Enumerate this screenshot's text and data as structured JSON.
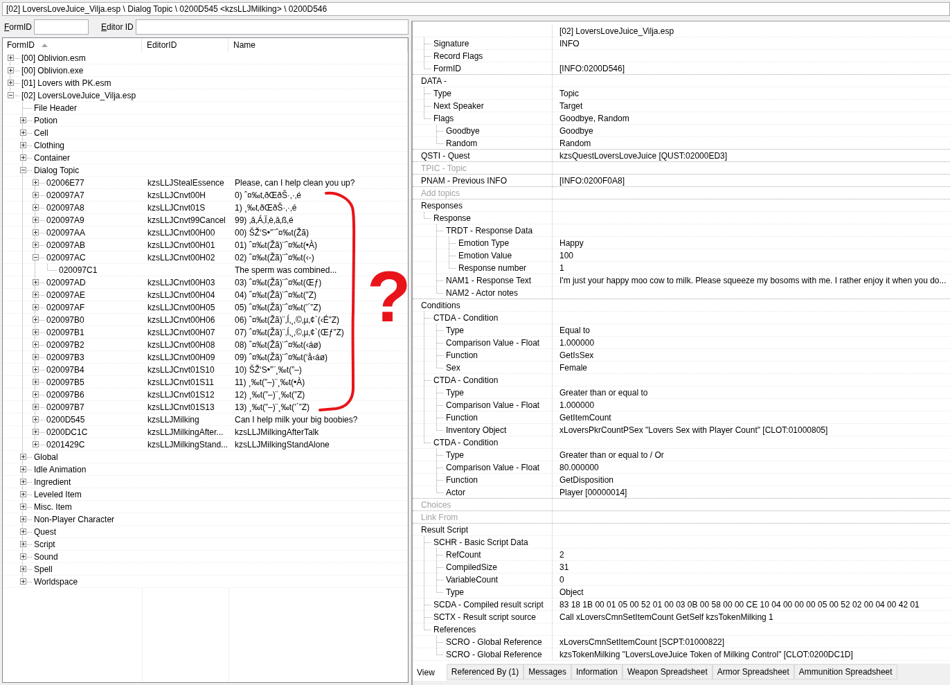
{
  "path_bar": "[02] LoversLoveJuice_Vilja.esp \\ Dialog Topic \\ 0200D545 <kzsLLJMilking> \\ 0200D546",
  "filters": [
    {
      "label": "FormID"
    },
    {
      "label": "Editor ID"
    }
  ],
  "record_tree": {
    "columns": [
      {
        "label": "FormID",
        "sorted": true
      },
      {
        "label": "EditorID",
        "sorted": false
      },
      {
        "label": "Name",
        "sorted": false
      }
    ],
    "nodes": [
      {
        "label": "[00] Oblivion.esm",
        "kind": "branch",
        "expanded": false
      },
      {
        "label": "[00] Oblivion.exe",
        "kind": "branch",
        "expanded": false
      },
      {
        "label": "[01] Lovers with PK.esm",
        "kind": "branch",
        "expanded": false
      },
      {
        "label": "[02] LoversLoveJuice_Vilja.esp",
        "kind": "branch",
        "expanded": true,
        "children": [
          {
            "label": "File Header",
            "kind": "leaf"
          },
          {
            "label": "Potion",
            "kind": "branch",
            "expanded": false
          },
          {
            "label": "Cell",
            "kind": "branch",
            "expanded": false
          },
          {
            "label": "Clothing",
            "kind": "branch",
            "expanded": false
          },
          {
            "label": "Container",
            "kind": "branch",
            "expanded": false
          },
          {
            "label": "Dialog Topic",
            "kind": "branch",
            "expanded": true,
            "children": [
              {
                "label": "02006E77",
                "editor_id": "kzsLLJStealEssence",
                "name": "Please, can I help clean you up?",
                "kind": "branch",
                "expanded": false
              },
              {
                "label": "020097A7",
                "editor_id": "kzsLLJCnvt00H",
                "name": "0) ˆ¤‰t‚ðŒðŠ·‚·‚é",
                "kind": "branch",
                "expanded": false
              },
              {
                "label": "020097A8",
                "editor_id": "kzsLLJCnvt01S",
                "name": "1) ¸‰t‚ðŒðŠ·‚·‚é",
                "kind": "branch",
                "expanded": false
              },
              {
                "label": "020097A9",
                "editor_id": "kzsLLJCnvt99Cancel",
                "name": "99) ‚â‚Á‚Ï‚è‚â‚ß‚é",
                "kind": "branch",
                "expanded": false
              },
              {
                "label": "020097AA",
                "editor_id": "kzsLLJCnvt00H00",
                "name": "00) ŠŽ‘S•”¨ˆ¤‰t(Žã)",
                "kind": "branch",
                "expanded": false
              },
              {
                "label": "020097AB",
                "editor_id": "kzsLLJCnvt00H01",
                "name": "01) ˆ¤‰t(Žã)¨ˆ¤‰t(•À)",
                "kind": "branch",
                "expanded": false
              },
              {
                "label": "020097AC",
                "editor_id": "kzsLLJCnvt00H02",
                "name": "02) ˆ¤‰t(Žã)¨ˆ¤‰t(‹-)",
                "kind": "branch",
                "expanded": true,
                "children": [
                  {
                    "label": "020097C1",
                    "name": "The sperm was combined...",
                    "kind": "leaf"
                  }
                ]
              },
              {
                "label": "020097AD",
                "editor_id": "kzsLLJCnvt00H03",
                "name": "03) ˆ¤‰t(Žã)¨ˆ¤‰t(Œƒ)",
                "kind": "branch",
                "expanded": false
              },
              {
                "label": "020097AE",
                "editor_id": "kzsLLJCnvt00H04",
                "name": "04) ˆ¤‰t(Žã)¨ˆ¤‰t(”Z)",
                "kind": "branch",
                "expanded": false
              },
              {
                "label": "020097AF",
                "editor_id": "kzsLLJCnvt00H05",
                "name": "05) ˆ¤‰t(Žã)¨ˆ¤‰t(’´”Z)",
                "kind": "branch",
                "expanded": false
              },
              {
                "label": "020097B0",
                "editor_id": "kzsLLJCnvt00H06",
                "name": "06) ˆ¤‰t(Žã)¨‚Í‚¸‚©‚µ‚¢`(‹É”Z)",
                "kind": "branch",
                "expanded": false
              },
              {
                "label": "020097B1",
                "editor_id": "kzsLLJCnvt00H07",
                "name": "07) ˆ¤‰t(Žã)¨‚Í‚¸‚©‚µ‚¢`(Œƒ”Z)",
                "kind": "branch",
                "expanded": false
              },
              {
                "label": "020097B2",
                "editor_id": "kzsLLJCnvt00H08",
                "name": "08) ˆ¤‰t(Žã)¨ˆ¤‰t(‹áø)",
                "kind": "branch",
                "expanded": false
              },
              {
                "label": "020097B3",
                "editor_id": "kzsLLJCnvt00H09",
                "name": "09) ˆ¤‰t(Žã)¨ˆ¤‰t(‘å‹áø)",
                "kind": "branch",
                "expanded": false
              },
              {
                "label": "020097B4",
                "editor_id": "kzsLLJCnvt01S10",
                "name": "10) ŠŽ‘S•”¨¸‰t(”–)",
                "kind": "branch",
                "expanded": false
              },
              {
                "label": "020097B5",
                "editor_id": "kzsLLJCnvt01S11",
                "name": "11) ¸‰t(”–)¨¸‰t(•À)",
                "kind": "branch",
                "expanded": false
              },
              {
                "label": "020097B6",
                "editor_id": "kzsLLJCnvt01S12",
                "name": "12) ¸‰t(”–)¨¸‰t(”Z)",
                "kind": "branch",
                "expanded": false
              },
              {
                "label": "020097B7",
                "editor_id": "kzsLLJCnvt01S13",
                "name": "13) ¸‰t(”–)¨¸‰t(’´”Z)",
                "kind": "branch",
                "expanded": false
              },
              {
                "label": "0200D545",
                "editor_id": "kzsLLJMilking",
                "name": "Can I help milk your big boobies?",
                "kind": "branch",
                "expanded": false
              },
              {
                "label": "0200DC1C",
                "editor_id": "kzsLLJMilkingAfter...",
                "name": "kzsLLJMilkingAfterTalk",
                "kind": "branch",
                "expanded": false
              },
              {
                "label": "0201429C",
                "editor_id": "kzsLLJMilkingStand...",
                "name": "kzsLLJMilkingStandAlone",
                "kind": "branch",
                "expanded": false
              }
            ]
          },
          {
            "label": "Global",
            "kind": "branch",
            "expanded": false
          },
          {
            "label": "Idle Animation",
            "kind": "branch",
            "expanded": false
          },
          {
            "label": "Ingredient",
            "kind": "branch",
            "expanded": false
          },
          {
            "label": "Leveled Item",
            "kind": "branch",
            "expanded": false
          },
          {
            "label": "Misc. Item",
            "kind": "branch",
            "expanded": false
          },
          {
            "label": "Non-Player Character",
            "kind": "branch",
            "expanded": false
          },
          {
            "label": "Quest",
            "kind": "branch",
            "expanded": false
          },
          {
            "label": "Script",
            "kind": "branch",
            "expanded": false
          },
          {
            "label": "Sound",
            "kind": "branch",
            "expanded": false
          },
          {
            "label": "Spell",
            "kind": "branch",
            "expanded": false
          },
          {
            "label": "Worldspace",
            "kind": "branch",
            "expanded": false
          }
        ]
      }
    ]
  },
  "record_view": {
    "fields": [
      {
        "value": "[02] LoversLoveJuice_Vilja.esp",
        "disabled": false,
        "children": [
          {
            "label": "Signature",
            "value": "INFO"
          },
          {
            "label": "Record Flags"
          },
          {
            "label": "FormID",
            "value": "[INFO:0200D546]"
          }
        ]
      },
      {
        "label": "DATA -",
        "disabled": false,
        "children": [
          {
            "label": "Type",
            "value": "Topic"
          },
          {
            "label": "Next Speaker",
            "value": "Target"
          },
          {
            "label": "Flags",
            "value": "Goodbye, Random",
            "children": [
              {
                "label": "Goodbye",
                "value": "Goodbye"
              },
              {
                "label": "Random",
                "value": "Random"
              }
            ]
          }
        ]
      },
      {
        "label": "QSTI - Quest",
        "value": "kzsQuestLoversLoveJuice [QUST:02000ED3]",
        "disabled": false
      },
      {
        "label": "TPIC - Topic",
        "disabled": true
      },
      {
        "label": "PNAM - Previous INFO",
        "value": "[INFO:0200F0A8]",
        "disabled": false
      },
      {
        "label": "Add topics",
        "disabled": true
      },
      {
        "label": "Responses",
        "disabled": false,
        "children": [
          {
            "label": "Response",
            "children": [
              {
                "label": "TRDT - Response Data",
                "children": [
                  {
                    "label": "Emotion Type",
                    "value": "Happy"
                  },
                  {
                    "label": "Emotion Value",
                    "value": "100"
                  },
                  {
                    "label": "Response number",
                    "value": "1"
                  }
                ]
              },
              {
                "label": "NAM1 - Response Text",
                "value": "I'm just your happy moo cow to milk. Please squeeze my bosoms with me. I rather enjoy it when you do..."
              },
              {
                "label": "NAM2 - Actor notes"
              }
            ]
          }
        ]
      },
      {
        "label": "Conditions",
        "disabled": false,
        "children": [
          {
            "label": "CTDA - Condition",
            "children": [
              {
                "label": "Type",
                "value": "Equal to"
              },
              {
                "label": "Comparison Value - Float",
                "value": "1.000000"
              },
              {
                "label": "Function",
                "value": "GetIsSex"
              },
              {
                "label": "Sex",
                "value": "Female"
              }
            ]
          },
          {
            "label": "CTDA - Condition",
            "children": [
              {
                "label": "Type",
                "value": "Greater than or equal to"
              },
              {
                "label": "Comparison Value - Float",
                "value": "1.000000"
              },
              {
                "label": "Function",
                "value": "GetItemCount"
              },
              {
                "label": "Inventory Object",
                "value": "xLoversPkrCountPSex \"Lovers Sex with Player Count\" [CLOT:01000805]"
              }
            ]
          },
          {
            "label": "CTDA - Condition",
            "children": [
              {
                "label": "Type",
                "value": "Greater than or equal to / Or"
              },
              {
                "label": "Comparison Value - Float",
                "value": "80.000000"
              },
              {
                "label": "Function",
                "value": "GetDisposition"
              },
              {
                "label": "Actor",
                "value": "Player [00000014]"
              }
            ]
          }
        ]
      },
      {
        "label": "Choices",
        "disabled": true
      },
      {
        "label": "Link From",
        "disabled": true
      },
      {
        "label": "Result Script",
        "disabled": false,
        "children": [
          {
            "label": "SCHR - Basic Script Data",
            "children": [
              {
                "label": "RefCount",
                "value": "2"
              },
              {
                "label": "CompiledSize",
                "value": "31"
              },
              {
                "label": "VariableCount",
                "value": "0"
              },
              {
                "label": "Type",
                "value": "Object"
              }
            ]
          },
          {
            "label": "SCDA - Compiled result script",
            "value": "83 18 1B 00 01 05 00 52 01 00 03 0B 00 58 00 00 CE 10 04 00 00 00 05 00 52 02 00 04 00 42 01"
          },
          {
            "label": "SCTX - Result script source",
            "value": "Call xLoversCmnSetItemCount GetSelf kzsTokenMilking 1"
          },
          {
            "label": "References",
            "children": [
              {
                "label": "SCRO - Global Reference",
                "value": "xLoversCmnSetItemCount [SCPT:01000822]"
              },
              {
                "label": "SCRO - Global Reference",
                "value": "kzsTokenMilking \"LoversLoveJuice Token of Milking Control\" [CLOT:0200DC1D]"
              }
            ]
          }
        ]
      }
    ]
  },
  "tabs": [
    {
      "label": "View",
      "selected": true
    },
    {
      "label": "Referenced By (1)",
      "selected": false
    },
    {
      "label": "Messages",
      "selected": false
    },
    {
      "label": "Information",
      "selected": false
    },
    {
      "label": "Weapon Spreadsheet",
      "selected": false
    },
    {
      "label": "Armor Spreadsheet",
      "selected": false
    },
    {
      "label": "Ammunition Spreadsheet",
      "selected": false
    }
  ],
  "annotation": {
    "mark": "?"
  }
}
